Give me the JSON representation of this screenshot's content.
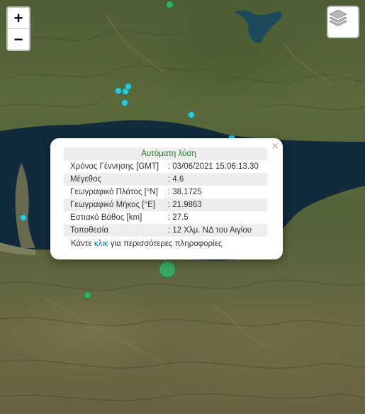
{
  "map": {
    "controls": {
      "zoom_in": "+",
      "zoom_out": "−",
      "layers_icon": "layers-icon"
    },
    "earthquakes": [
      {
        "color": "#2ec9d4"
      },
      {
        "color": "#34b15a"
      },
      {
        "color": "#3aa864",
        "selected": true
      }
    ]
  },
  "popup": {
    "title": "Αυτόματη λύση",
    "rows": [
      {
        "label": "Χρόνος Γέννησης [GMT]",
        "value": ": 03/06/2021 15:06:13.30"
      },
      {
        "label": "Μέγεθος",
        "value": ": 4.6"
      },
      {
        "label": "Γεωγραφικό Πλάτος [°N]",
        "value": ": 38.1725"
      },
      {
        "label": "Γεωγραφικό Μήκος [°E]",
        "value": ": 21.9863"
      },
      {
        "label": "Εστιακό Βάθος [km]",
        "value": ": 27.5"
      },
      {
        "label": "Τοποθεσία",
        "value": ": 12 Χλμ. ΝΔ του Αιγίου"
      }
    ],
    "more_prefix": "Κάντε ",
    "more_link": "κλικ",
    "more_suffix": " για περισσότερες πληροφορίες",
    "close": "×"
  }
}
